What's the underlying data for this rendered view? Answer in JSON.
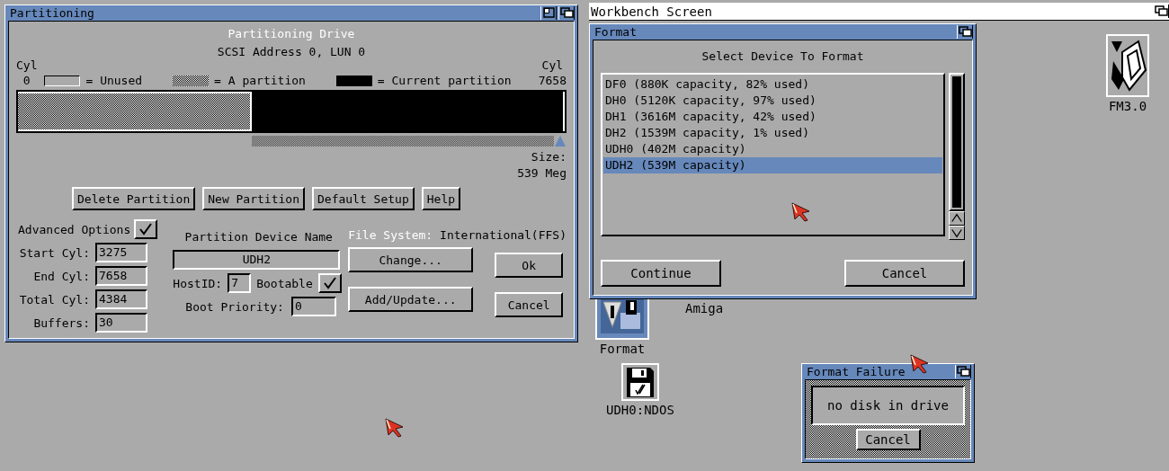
{
  "screen_title": "Workbench Screen",
  "partitioning_window": {
    "title": "Partitioning",
    "heading": "Partitioning Drive",
    "subheading": "SCSI Address 0, LUN 0",
    "cyl_start": {
      "label": "Cyl",
      "value": "0"
    },
    "cyl_end": {
      "label": "Cyl",
      "value": "7658"
    },
    "legend": [
      {
        "kind": "unused",
        "label": "= Unused"
      },
      {
        "kind": "partition",
        "label": "= A partition"
      },
      {
        "kind": "current",
        "label": "= Current partition"
      }
    ],
    "drive_bar": [
      {
        "kind": "partition",
        "level": 0.428
      },
      {
        "kind": "current",
        "level": 0.572
      }
    ],
    "size_label": "Size:",
    "size_value": "539 Meg",
    "buttons": [
      "Delete Partition",
      "New Partition",
      "Default Setup",
      "Help"
    ],
    "advanced_options": {
      "label": "Advanced Options",
      "checked": true
    },
    "fields": [
      {
        "label": "Start Cyl:",
        "value": "3275"
      },
      {
        "label": "End Cyl:",
        "value": "7658"
      },
      {
        "label": "Total Cyl:",
        "value": "4384"
      },
      {
        "label": "Buffers:",
        "value": "30"
      }
    ],
    "device_name": {
      "label": "Partition Device Name",
      "value": "UDH2"
    },
    "host_id": {
      "label": "HostID:",
      "value": "7"
    },
    "bootable": {
      "label": "Bootable",
      "checked": true
    },
    "boot_priority": {
      "label": "Boot Priority:",
      "value": "0"
    },
    "file_system": {
      "label": "File System:",
      "value": "International(FFS)"
    },
    "fs_buttons": [
      "Change...",
      "Add/Update..."
    ],
    "dialog_buttons": [
      "Ok",
      "Cancel"
    ]
  },
  "format_window": {
    "title": "Format",
    "heading": "Select Device To Format",
    "devices": [
      {
        "label": "DF0 (880K capacity, 82% used)",
        "selected": false
      },
      {
        "label": "DH0 (5120K capacity, 97% used)",
        "selected": false
      },
      {
        "label": "DH1 (3616M capacity, 42% used)",
        "selected": false
      },
      {
        "label": "DH2 (1539M capacity, 1% used)",
        "selected": false
      },
      {
        "label": "UDH0 (402M capacity)",
        "selected": false
      },
      {
        "label": "UDH2 (539M capacity)",
        "selected": true
      }
    ],
    "buttons": [
      "Continue",
      "Cancel"
    ]
  },
  "desktop_icons": [
    {
      "kind": "tool",
      "label": "FM3.0"
    },
    {
      "kind": "hidden",
      "label": "Amiga"
    },
    {
      "kind": "format",
      "label": "Format"
    },
    {
      "kind": "disk",
      "label": "UDH0:NDOS"
    }
  ],
  "failure_window": {
    "title": "Format Failure",
    "message": "no disk in drive",
    "button": "Cancel"
  }
}
